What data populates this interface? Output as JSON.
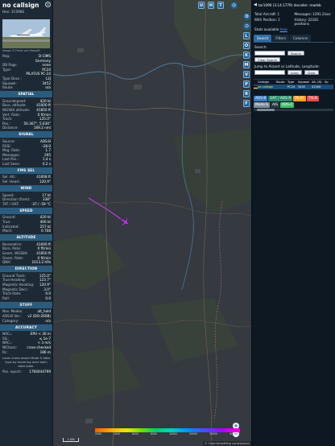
{
  "info": {
    "callsign": "no callsign",
    "hex": "Hex: 3C098E",
    "photo_credit": "Image © Frank van Hasselt",
    "reg_fields": [
      {
        "k": "Reg.:",
        "v": "D-CIMS"
      },
      {
        "k": "",
        "v": "Germany"
      },
      {
        "k": "DB flags:",
        "v": "none"
      },
      {
        "k": "Type:",
        "v": "PC24"
      },
      {
        "k": "",
        "v": "PILATUS PC-24"
      },
      {
        "k": "Type Desc.:",
        "v": "L2J"
      },
      {
        "k": "Squawk:",
        "v": "3452"
      },
      {
        "k": "Route:",
        "v": "n/a"
      }
    ],
    "sections": [
      {
        "title": "SPATIAL",
        "rows": [
          {
            "k": "Groundspeed:",
            "v": "420 kt"
          },
          {
            "k": "Baro. altitude:",
            "v": "41000 ft"
          },
          {
            "k": "WGS84 altitude:",
            "v": "41850 ft"
          },
          {
            "k": "Vert. Rate:",
            "v": "0 ft/min"
          },
          {
            "k": "Track:",
            "v": "125.0°"
          },
          {
            "k": "Pos.:",
            "v": "50.367°, 5.630°"
          },
          {
            "k": "Distance:",
            "v": "169.2 nmi"
          }
        ]
      },
      {
        "title": "SIGNAL",
        "rows": [
          {
            "k": "Source:",
            "v": "ADS-B"
          },
          {
            "k": "RSSI:",
            "v": "-28.0"
          },
          {
            "k": "Msg. Rate:",
            "v": "1.7"
          },
          {
            "k": "Messages:",
            "v": "295"
          },
          {
            "k": "Last Pos.:",
            "v": "1.4 s"
          },
          {
            "k": "Last Seen:",
            "v": "0.2 s"
          }
        ]
      },
      {
        "title": "FMS SEL",
        "rows": [
          {
            "k": "Sel. Alt.:",
            "v": "41008 ft"
          },
          {
            "k": "Sel. Head.:",
            "v": "120.9°"
          }
        ]
      },
      {
        "title": "WIND",
        "rows": [
          {
            "k": "Speed:",
            "v": "17 kt"
          },
          {
            "k": "Direction (from):",
            "v": "338°"
          },
          {
            "k": "TAT / OAT:",
            "v": "-37 / -59 °C"
          }
        ]
      },
      {
        "title": "SPEED",
        "rows": [
          {
            "k": "Ground:",
            "v": "420 kt"
          },
          {
            "k": "True:",
            "v": "406 kt"
          },
          {
            "k": "Indicated:",
            "v": "257 kt"
          },
          {
            "k": "Mach:",
            "v": "0.708"
          }
        ]
      },
      {
        "title": "ALTITUDE",
        "rows": [
          {
            "k": "Barometric:",
            "v": "41000 ft"
          },
          {
            "k": "Baro. Rate:",
            "v": "0 ft/min"
          },
          {
            "k": "Geom. WGS84:",
            "v": "41850 ft"
          },
          {
            "k": "Geom. Rate:",
            "v": "0 ft/min"
          },
          {
            "k": "QNH:",
            "v": "1013.2 hPa"
          }
        ]
      },
      {
        "title": "DIRECTION",
        "rows": [
          {
            "k": "Ground Track:",
            "v": "125.0°"
          },
          {
            "k": "True Heading:",
            "v": "123.7°"
          },
          {
            "k": "Magnetic Heading:",
            "v": "120.9°"
          },
          {
            "k": "Magnetic Decl.:",
            "v": "3.0°"
          },
          {
            "k": "Track Rate:",
            "v": "0.0"
          },
          {
            "k": "Roll:",
            "v": "0.0"
          }
        ]
      },
      {
        "title": "STUFF",
        "rows": [
          {
            "k": "Nav. Modes:",
            "v": "alt_hold"
          },
          {
            "k": "ADS-B Ver.:",
            "v": "v2 (DO-260B)"
          },
          {
            "k": "Category:",
            "v": "n/a"
          }
        ]
      },
      {
        "title": "ACCURACY",
        "rows": [
          {
            "k": "NACₚ:",
            "v": "EPU < 30 m"
          },
          {
            "k": "SIL:",
            "v": "≤ 1e-7"
          },
          {
            "k": "NACᵥ:",
            "v": "< 3 m/s"
          },
          {
            "k": "NICbaro:",
            "v": "cross-checked"
          },
          {
            "k": "Rc:",
            "v": "186 m"
          }
        ]
      }
    ],
    "note": "Learn more about Mode S data type by hovering over each data label.",
    "pos_epoch_label": "Pos. epoch:",
    "pos_epoch_value": "1760444799"
  },
  "map": {
    "top_buttons": [
      "U",
      "H",
      "T"
    ],
    "side_buttons": [
      "L",
      "O",
      "K",
      "M",
      "V",
      "P",
      "R",
      "F"
    ],
    "scale": "2 NM",
    "colorbar_labels": [
      "2000",
      "4000",
      "6000",
      "8000",
      "10000",
      "20000",
      "30000",
      "40000+"
    ],
    "osm": "© OpenStreetMap contributors",
    "zoom_in": "+",
    "zoom_out": "−"
  },
  "right": {
    "version": "tar1090 (3.14.1779) decoder: readsb",
    "total_aircraft_label": "Total Aircraft: 1",
    "messages_label": "Messages: 1291.2/sec",
    "with_position_label": "With Position: 1",
    "history_label": "History: 22181 positions",
    "stats_label": "Stats available",
    "stats_link": "here",
    "tabs": [
      "Search",
      "Filters",
      "Columns"
    ],
    "search_label": "Search:",
    "search_button": "Search",
    "clear_search_button": "Clear Search",
    "jump_label": "Jump to Airport or Latitude, Longitude:",
    "jump_button": "Jump",
    "clear_button": "Clear",
    "table_headers": [
      "Callsign",
      "Route",
      "Type",
      "Squawk",
      "Alt. (ft)",
      "Sp"
    ],
    "table_rows": [
      [
        "no callsign",
        "",
        "PC24",
        "3452",
        "41000",
        ""
      ]
    ],
    "legend": [
      {
        "label": "ADS-B",
        "bg": "#3b7bbf"
      },
      {
        "label": "UAT / ADS-R",
        "bg": "#2a8a6a"
      },
      {
        "label": "MLAT",
        "bg": "#ff9d24"
      },
      {
        "label": "TIS-B",
        "bg": "#e84b4b"
      },
      {
        "label": "Mode-S",
        "bg": "#7d8d99"
      },
      {
        "label": "AIS",
        "bg": "#2a3a48"
      },
      {
        "label": "ADS-C",
        "bg": "#3fbf6a"
      }
    ]
  }
}
